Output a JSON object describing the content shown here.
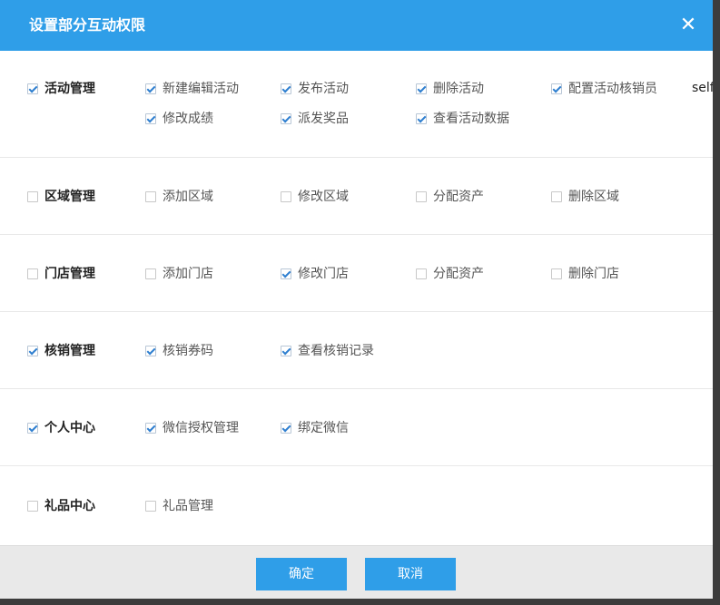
{
  "dialog": {
    "title": "设置部分互动权限",
    "close_glyph": "✕"
  },
  "stray_text": "self",
  "sections": [
    {
      "name": "活动管理",
      "checked": true,
      "items": [
        {
          "label": "新建编辑活动",
          "checked": true
        },
        {
          "label": "发布活动",
          "checked": true
        },
        {
          "label": "删除活动",
          "checked": true
        },
        {
          "label": "配置活动核销员",
          "checked": true
        },
        {
          "label": "修改成绩",
          "checked": true
        },
        {
          "label": "派发奖品",
          "checked": true
        },
        {
          "label": "查看活动数据",
          "checked": true
        }
      ]
    },
    {
      "name": "区域管理",
      "checked": false,
      "items": [
        {
          "label": "添加区域",
          "checked": false
        },
        {
          "label": "修改区域",
          "checked": false
        },
        {
          "label": "分配资产",
          "checked": false
        },
        {
          "label": "删除区域",
          "checked": false
        }
      ]
    },
    {
      "name": "门店管理",
      "checked": false,
      "items": [
        {
          "label": "添加门店",
          "checked": false
        },
        {
          "label": "修改门店",
          "checked": true
        },
        {
          "label": "分配资产",
          "checked": false
        },
        {
          "label": "删除门店",
          "checked": false
        }
      ]
    },
    {
      "name": "核销管理",
      "checked": true,
      "items": [
        {
          "label": "核销券码",
          "checked": true
        },
        {
          "label": "查看核销记录",
          "checked": true
        }
      ]
    },
    {
      "name": "个人中心",
      "checked": true,
      "items": [
        {
          "label": "微信授权管理",
          "checked": true
        },
        {
          "label": "绑定微信",
          "checked": true
        }
      ]
    },
    {
      "name": "礼品中心",
      "checked": false,
      "items": [
        {
          "label": "礼品管理",
          "checked": false
        }
      ]
    }
  ],
  "footer": {
    "confirm_label": "确定",
    "cancel_label": "取消"
  }
}
